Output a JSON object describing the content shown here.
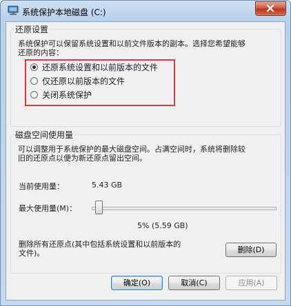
{
  "window": {
    "title": "系统保护本地磁盘 (C:)"
  },
  "restore": {
    "group_title": "还原设置",
    "description_line1": "系统保护可以保留系统设置和以前文件版本的副本。选择您希望能够",
    "description_line2": "还原的内容：",
    "options": [
      {
        "label": "还原系统设置和以前版本的文件",
        "checked": true
      },
      {
        "label": "仅还原以前版本的文件",
        "checked": false
      },
      {
        "label": "关闭系统保护",
        "checked": false
      }
    ]
  },
  "disk": {
    "group_title": "磁盘空间使用量",
    "description_line1": "可以调整用于系统保护的最大磁盘空间。占满空间时，系统将删除较",
    "description_line2": "旧的还原点以便为新还原点留出空间。",
    "current_usage_label": "当前使用量：",
    "current_usage_value": "5.43 GB",
    "max_usage_label": "最大使用量(M)：",
    "max_usage_value": "5% (5.59 GB)",
    "max_usage_percent": 5,
    "delete_text_line1": "删除所有还原点(其中包括系统设置和以前版本的",
    "delete_text_line2": "文件)。",
    "delete_button": "删除(D)"
  },
  "footer": {
    "ok": "确定(O)",
    "cancel": "取消(C)",
    "apply": "应用(A)"
  },
  "colors": {
    "highlight": "#e0353b",
    "close_button": "#c9503a"
  }
}
